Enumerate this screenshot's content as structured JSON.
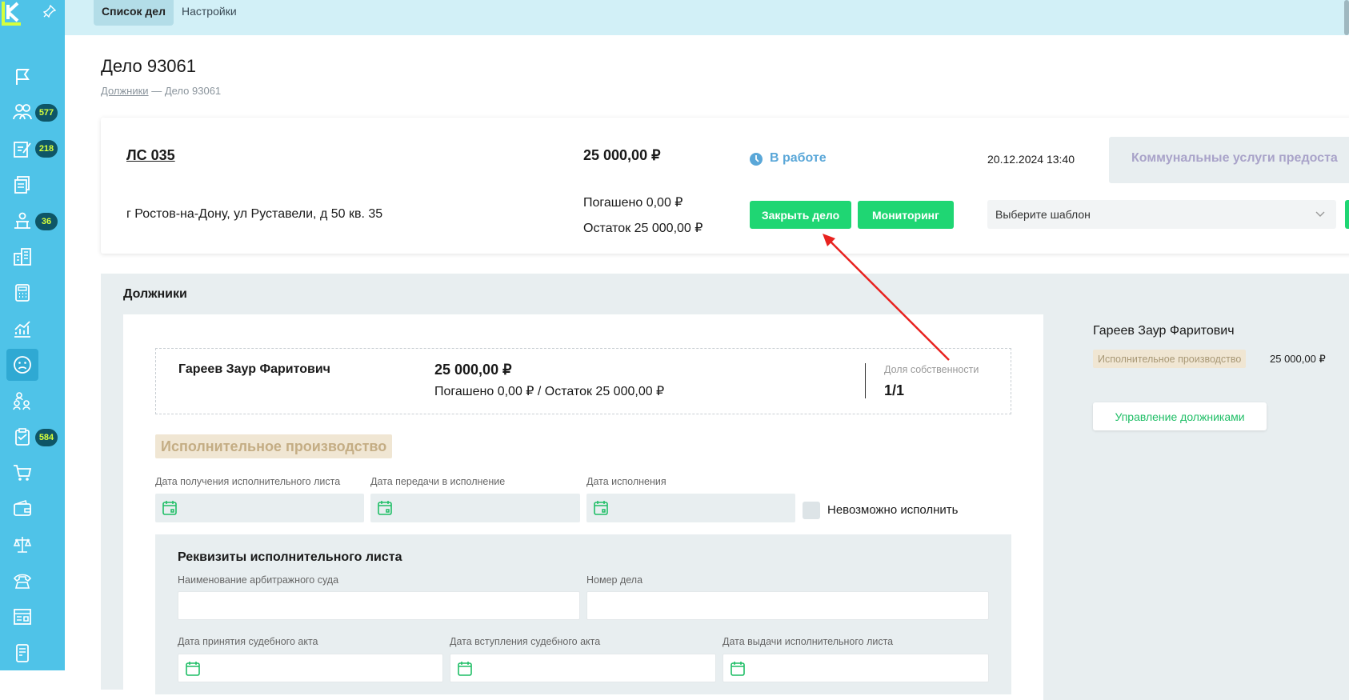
{
  "tabs": {
    "cases": "Список дел",
    "settings": "Настройки"
  },
  "page": {
    "title": "Дело 93061",
    "breadcrumb_link": "Должники",
    "breadcrumb_sep": "—",
    "breadcrumb_current": "Дело 93061"
  },
  "sidebar": {
    "badges": {
      "debtors": "577",
      "edits": "218",
      "hearings": "36",
      "tasks": "584"
    }
  },
  "case": {
    "account": "ЛС 035",
    "amount": "25 000,00 ₽",
    "status": "В работе",
    "datetime": "20.12.2024 13:40",
    "service": "Коммунальные услуги предоста",
    "address": "г Ростов-на-Дону, ул Руставели, д 50 кв. 35",
    "paid": "Погашено 0,00 ₽",
    "remaining": "Остаток 25 000,00 ₽",
    "close_btn": "Закрыть дело",
    "monitor_btn": "Мониторинг",
    "template_placeholder": "Выберите шаблон"
  },
  "debtors_section": {
    "title": "Должники",
    "debtor_name": "Гареев Заур Фаритович",
    "debtor_amount": "25 000,00 ₽",
    "debtor_paid_rest": "Погашено 0,00 ₽ / Остаток 25 000,00 ₽",
    "share_label": "Доля собственности",
    "share_value": "1/1",
    "stage_title": "Исполнительное производство",
    "fields": {
      "date_received": "Дата получения исполнительного листа",
      "date_transfer": "Дата передачи в исполнение",
      "date_exec": "Дата исполнения",
      "impossible": "Невозможно исполнить"
    },
    "requisites": {
      "title": "Реквизиты исполнительного листа",
      "court_name": "Наименование арбитражного суда",
      "case_number": "Номер дела",
      "date_act": "Дата принятия судебного акта",
      "date_effective": "Дата вступления судебного акта",
      "date_issue": "Дата выдачи исполнительного листа"
    }
  },
  "right_panel": {
    "name": "Гареев Заур Фаритович",
    "stage": "Исполнительное производство",
    "amount": "25 000,00 ₽",
    "manage_btn": "Управление должниками"
  },
  "colors": {
    "sidebar": "#4fc3e8",
    "green": "#1fd673",
    "status_blue": "#5aa7d8",
    "arrow": "#e8221f"
  }
}
